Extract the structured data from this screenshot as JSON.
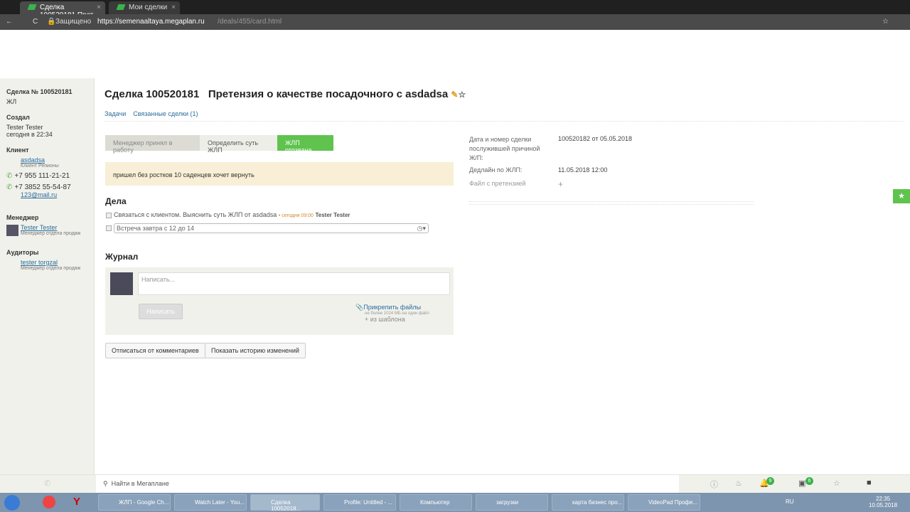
{
  "browser": {
    "tabs": [
      "Сделка 100520181 Прет",
      "Мои сделки"
    ],
    "secure": "Защищено",
    "url_host": "https://semenaaltaya.megaplan.ru",
    "url_path": "/deals/455/card.html"
  },
  "sidebar": {
    "deal": "Сделка № 100520181",
    "type": "ЖЛ",
    "created_label": "Создал",
    "creator": "Tester Tester",
    "created_time": "сегодня в 22:34",
    "client_label": "Клиент",
    "client": "asdadsa",
    "client_sub": "Клиент Репионы",
    "phone1": "+7 955 111-21-21",
    "phone2": "+7 3852 55-54-87",
    "email": "123@mail.ru",
    "manager_label": "Менеджер",
    "manager": "Tester Tester",
    "manager_sub": "Менеджер отдела продаж",
    "auditors_label": "Аудиторы",
    "auditor": "tester torgzal",
    "auditor_sub": "Менеджер отдела продаж"
  },
  "main": {
    "title": "Сделка 100520181   Претензия о качестве посадочного с asdadsa",
    "links": [
      "Задачи",
      "Связанные сделки (1)"
    ],
    "stages": [
      "Менеджер принял в работу",
      "Определить суть ЖЛП",
      "ЖЛП отозвана."
    ],
    "note": "пришел без ростков 10 саденцев хочет вернуть",
    "tasks_title": "Дела",
    "task1": "Связаться с клиентом. Выяснить суть ЖЛП от asdadsa",
    "task1_time": "• сегодня 09:00",
    "task1_user": "Tester Tester",
    "task2": "Встреча завтра с 12 до 14",
    "journal_title": "Журнал",
    "journal_placeholder": "Написать...",
    "write_btn": "Написать",
    "attach": "Прикрепить файлы",
    "attach_sub": "не более 1024 МБ на один файл",
    "template": "из шаблона",
    "unsubscribe": "Отписаться от комментариев",
    "history": "Показать историю изменений"
  },
  "fields": [
    {
      "label": "Дата и номер сделки послужившей причиной Ж/П:",
      "value": "100520182 от 05.05.2018"
    },
    {
      "label": "Дедлайн по ЖЛП:",
      "value": "11.05.2018 12:00"
    },
    {
      "label": "Файл с претензией",
      "value": "+"
    }
  ],
  "bottom": {
    "search_placeholder": "Найти в Мегаплане",
    "notif_count": "9",
    "msg_count": "6"
  },
  "taskbar": {
    "items": [
      "ЖЛП - Google Ch...",
      "Watch Later - You...",
      "Сделка 10052018...",
      "Profile: Untitled - ...",
      "Компьютер",
      "загрузки",
      "карта бизнес про...",
      "VideoPad Профе..."
    ],
    "lang": "RU",
    "time": "22:35",
    "date": "10.05.2018"
  }
}
